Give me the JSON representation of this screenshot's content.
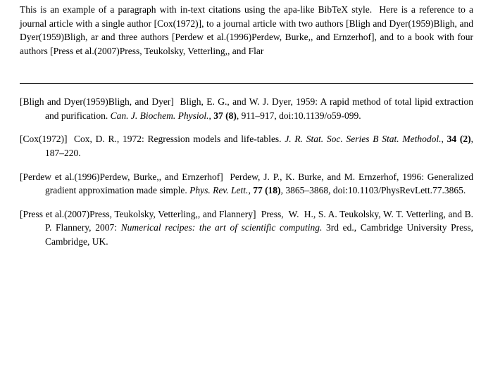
{
  "intro": {
    "text_parts": [
      "This is an example of a paragraph with in-text citations using the apa-like BibTeX style.  Here is a reference to a journal article with a single author [Cox(1972)], to a journal article with two authors [Bligh and Dyer(1959)Bligh, and Dyer(1959)Bligh, ar and three authors [Perdew et al.(1996)Perdew, Burke,, and Ernzerhof], and to a book with four authors [Press et al.(2007)Press, Teukolsky, Vetterling,, and Flar"
    ]
  },
  "references": {
    "section_separator": true,
    "entries": [
      {
        "id": "bligh1959",
        "key_label": "[Bligh and Dyer(1959)Bligh, and Dyer]",
        "text": "Bligh, E. G., and W. J. Dyer, 1959: A rapid method of total lipid extraction and purification.",
        "journal": "Can. J. Biochem. Physiol.",
        "volume_issue": "37 (8)",
        "pages_doi": ", 911–917, doi:10.1139/o59-099."
      },
      {
        "id": "cox1972",
        "key_label": "[Cox(1972)]",
        "text": "Cox, D. R., 1972: Regression models and life-tables.",
        "journal": "J. R. Stat. Soc. Series B Stat. Methodol.",
        "volume_issue": "34 (2)",
        "pages_doi": ", 187–220."
      },
      {
        "id": "perdew1996",
        "key_label": "[Perdew et al.(1996)Perdew, Burke,, and Ernzerhof]",
        "text": "Perdew, J. P., K. Burke, and M. Ernzerhof, 1996: Generalized gradient approximation made simple.",
        "journal": "Phys. Rev. Lett.",
        "volume_issue": "77 (18)",
        "pages_doi": ", 3865–3868, doi:10.1103/PhysRevLett.77.3865."
      },
      {
        "id": "press2007",
        "key_label": "[Press et al.(2007)Press, Teukolsky, Vetterling,, and Flannery]",
        "text": "Press,  W.  H., S. A. Teukolsky, W. T. Vetterling, and B. P. Flannery, 2007:",
        "book_title": "Numerical recipes: the art of scientific computing.",
        "book_rest": " 3rd ed., Cambridge University Press, Cambridge, UK."
      }
    ]
  }
}
